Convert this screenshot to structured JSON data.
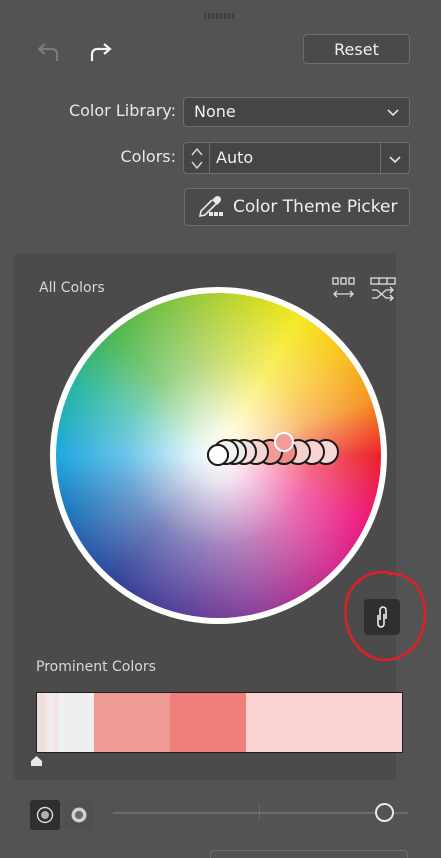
{
  "toolbar": {
    "undo_icon": "undo-icon",
    "redo_icon": "redo-icon",
    "reset_label": "Reset"
  },
  "color_library": {
    "label": "Color Library:",
    "value": "None"
  },
  "colors": {
    "label": "Colors:",
    "value": "Auto"
  },
  "picker": {
    "label": "Color Theme Picker",
    "icon": "eyedropper-icon"
  },
  "panel": {
    "all_colors_label": "All Colors",
    "prominent_label": "Prominent Colors",
    "link_icon": "link-icon"
  },
  "wheel": {
    "handles": [
      "#ffffff",
      "#f4f4f4",
      "#f1ecec",
      "#f6dede",
      "#f7d3d2",
      "#f39b97",
      "#f08b86",
      "#f4cfcc",
      "#f7d4d2",
      "#f6d8d6"
    ],
    "selected": "#f39b97"
  },
  "prominent_colors": [
    {
      "color": "#eee0e0",
      "weight": 1
    },
    {
      "color": "#f2dcdc",
      "weight": 1
    },
    {
      "color": "#f6e6e6",
      "weight": 1
    },
    {
      "color": "#f0eaea",
      "weight": 1.5
    },
    {
      "color": "#f4e2e2",
      "weight": 1
    },
    {
      "color": "#efefef",
      "weight": 9.5
    },
    {
      "color": "#f19b96",
      "weight": 20
    },
    {
      "color": "#f07f7b",
      "weight": 20
    },
    {
      "color": "#f8d3d1",
      "weight": 41
    }
  ],
  "view": {
    "slider_value": 1.0
  }
}
